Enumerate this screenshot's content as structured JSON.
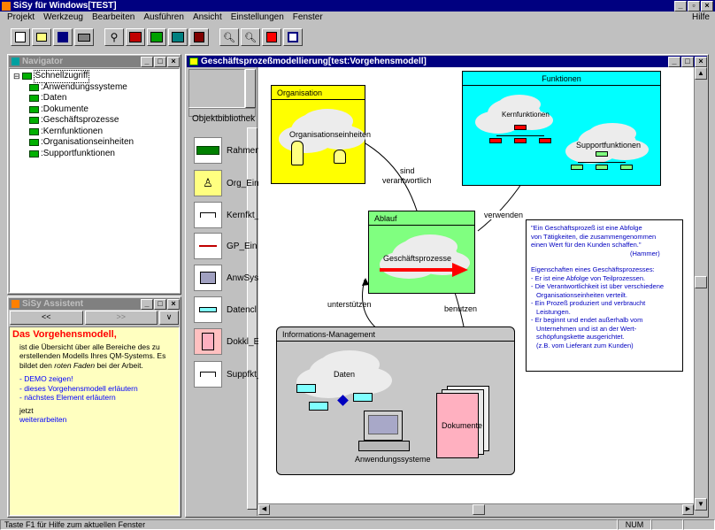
{
  "app": {
    "title": "SiSy für Windows[TEST]",
    "help": "Hilfe"
  },
  "menu": [
    "Projekt",
    "Werkzeug",
    "Bearbeiten",
    "Ausführen",
    "Ansicht",
    "Einstellungen",
    "Fenster"
  ],
  "toolbar": [
    "new-icon",
    "open-icon",
    "save-icon",
    "print-icon",
    "binoculars-icon",
    "image-icon",
    "grid-icon",
    "tree-icon",
    "export-icon",
    "zoom-in-icon",
    "zoom-out-icon",
    "tools-icon",
    "window-icon"
  ],
  "navigator": {
    "title": "Navigator",
    "root": "Schnellzugriff",
    "items": [
      ":Anwendungssysteme",
      ":Daten",
      ":Dokumente",
      ":Geschäftsprozesse",
      ":Kernfunktionen",
      ":Organisationseinheiten",
      ":Supportfunktionen"
    ]
  },
  "assistant": {
    "title": "SiSy Assistent",
    "nav": [
      "<<",
      ">>",
      "∨"
    ],
    "heading": "Das Vorgehensmodell,",
    "text1": "ist die Übersicht über alle Bereiche des zu erstellenden Modells Ihres QM-Systems. Es bildet den ",
    "text_italic": "roten Faden",
    "text2": " bei der Arbeit.",
    "links": [
      "- DEMO zeigen!",
      "- dieses Vorgehensmodell erläutern",
      "- nächstes Element erläutern"
    ],
    "jetzt": "jetzt",
    "continue": "weiterarbeiten"
  },
  "library": {
    "title": "Objektbibliothek",
    "items": [
      "Rahmen",
      "Org_Ein",
      "Kernfkt_",
      "GP_Ein",
      "AnwSys",
      "Datencl",
      "Dokkl_E",
      "Suppfkt_"
    ]
  },
  "diagram": {
    "title": "Geschäftsprozeßmodellierung[test:Vorgehensmodell]",
    "colors": {
      "organisation": "#ffff00",
      "funktionen": "#00ffff",
      "ablauf": "#80ff80",
      "info": "#c0c0c0",
      "red": "#ff0000"
    },
    "organisation": {
      "title": "Organisation",
      "label": "Organisationseinheiten"
    },
    "funktionen": {
      "title": "Funktionen",
      "kern": "Kernfunktionen",
      "support": "Supportfunktionen"
    },
    "ablauf": {
      "title": "Ablauf",
      "label": "Geschäftsprozesse"
    },
    "info": {
      "title": "Informations-Management",
      "daten": "Daten",
      "dokumente": "Dokumente",
      "anwendung": "Anwendungssysteme"
    },
    "edges": {
      "sind1": "sind",
      "sind2": "verantwortlich",
      "verwenden": "verwenden",
      "unterstuetzen": "unterstützen",
      "benutzen": "benutzen"
    },
    "note": {
      "quote1": "\"Ein Geschäftsprozeß ist eine Abfolge",
      "quote2": "von Tätigkeiten, die zusammengenommen",
      "quote3": "einen Wert für den Kunden schaffen.\"",
      "author": "(Hammer)",
      "heading": "Eigenschaften eines Geschäftsprozesses:",
      "lines": [
        "- Er ist eine Abfolge von Teilprozessen.",
        "- Die Verantwortlichkeit ist über verschiedene",
        "  Organisationseinheiten verteilt.",
        "- Ein Prozeß produziert und verbraucht",
        "  Leistungen.",
        "- Er beginnt und endet außerhalb vom",
        "  Unternehmen und ist an der Wert-",
        "  schöpfungskette ausgerichtet.",
        "  (z.B. vom Lieferant zum Kunden)"
      ]
    }
  },
  "status": {
    "text": "Taste F1 für Hilfe zum aktuellen Fenster",
    "num": "NUM"
  }
}
